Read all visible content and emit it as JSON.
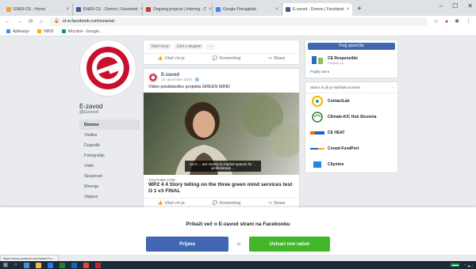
{
  "browser": {
    "tabs": [
      {
        "label": "ENER-CE - Home",
        "fav_color": "#f0a030"
      },
      {
        "label": "ENER-CE - Domov | Facebook",
        "fav_color": "#3b5998"
      },
      {
        "label": "Ongoing projects | Interreg - C",
        "fav_color": "#c0392b"
      },
      {
        "label": "Google Prevajalnik",
        "fav_color": "#4285f4"
      },
      {
        "label": "E-zavod - Domov | Facebook",
        "fav_color": "#3b5998"
      }
    ],
    "new_tab": "+",
    "url": "sl-si.facebook.com/ezavod",
    "bookmarks": [
      {
        "label": "Aplikacije",
        "color": "#4285f4"
      },
      {
        "label": "INBIZ",
        "color": "#f4b400"
      },
      {
        "label": "Moj disk - Google...",
        "color": "#0f9d58"
      }
    ]
  },
  "left": {
    "page_name": "E-zavod",
    "handle": "@Ezavod",
    "nav": [
      "Domov",
      "Vizitka",
      "Dogodki",
      "Fotografije",
      "Videi",
      "Skupnost",
      "Mnenja",
      "Objave"
    ]
  },
  "post_top": {
    "reactions": [
      "Všeč mi je",
      "Deli z drugimi",
      "···"
    ],
    "actions": [
      "Všeč mi je",
      "Komentiraj",
      "Share"
    ]
  },
  "post": {
    "author": "E-zavod",
    "date": "19. december 2019 · 🌐",
    "text": "Video predstavitev projekta GREEN MIND",
    "video_caption": "so in ... are mostly to market spaces for ... professional ...",
    "link_domain": "YOUTUBE.COM",
    "link_title": "WP2 4 4 Story telling on the three green mind services test O 1 v3 FINAL",
    "actions": [
      "Všeč mi je",
      "Komentiraj",
      "Share"
    ]
  },
  "right": {
    "follow_label": "Prejj sporočilo",
    "sponsor_name": "CE Responsible",
    "sponsor_sub": "Podjetje za ...",
    "see_all": "Poglej vse ▸",
    "liked_header": "Strani, ki jih je všečkala ta stran",
    "liked_arrow": "›",
    "suggestions": [
      {
        "name": "ContactLab",
        "icon": "icon-contactlab"
      },
      {
        "name": "Climate-KIC Hub Slovenia",
        "icon": "icon-climate"
      },
      {
        "name": "CE HEAT",
        "icon": "icon-ceheat"
      },
      {
        "name": "Crowd-FundPort",
        "icon": "icon-crowd"
      },
      {
        "name": "Citymize",
        "icon": "icon-citymize"
      }
    ]
  },
  "overlay": {
    "title": "Prikaži več o E-zavod strani na Facebooku",
    "login": "Prijava",
    "or": "ali",
    "new_account": "Ustvari nov račun"
  },
  "status_url": "https://www.youtube.com/watch?v=..."
}
